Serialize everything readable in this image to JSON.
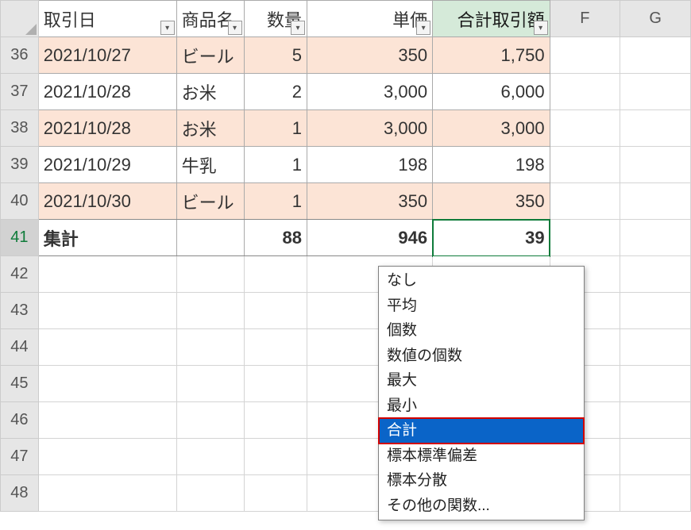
{
  "headers": {
    "date": "取引日",
    "name": "商品名",
    "qty": "数量",
    "price": "単価",
    "total": "合計取引額",
    "colF": "F",
    "colG": "G"
  },
  "rowNumbersTop": [
    "36",
    "37",
    "38",
    "39",
    "40",
    "41"
  ],
  "rowNumbersBottom": [
    "42",
    "43",
    "44",
    "45",
    "46",
    "47",
    "48"
  ],
  "rows": [
    {
      "date": "2021/10/27",
      "name": "ビール",
      "qty": "5",
      "price": "350",
      "total": "1,750",
      "banded": true
    },
    {
      "date": "2021/10/28",
      "name": "お米",
      "qty": "2",
      "price": "3,000",
      "total": "6,000",
      "banded": false
    },
    {
      "date": "2021/10/28",
      "name": "お米",
      "qty": "1",
      "price": "3,000",
      "total": "3,000",
      "banded": true
    },
    {
      "date": "2021/10/29",
      "name": "牛乳",
      "qty": "1",
      "price": "198",
      "total": "198",
      "banded": false
    },
    {
      "date": "2021/10/30",
      "name": "ビール",
      "qty": "1",
      "price": "350",
      "total": "350",
      "banded": true
    }
  ],
  "totalRow": {
    "label": "集計",
    "qty": "88",
    "price": "946",
    "total": "39"
  },
  "dropdown": {
    "items": [
      "なし",
      "平均",
      "個数",
      "数値の個数",
      "最大",
      "最小",
      "合計",
      "標本標準偏差",
      "標本分散",
      "その他の関数..."
    ],
    "selectedIndex": 6
  }
}
